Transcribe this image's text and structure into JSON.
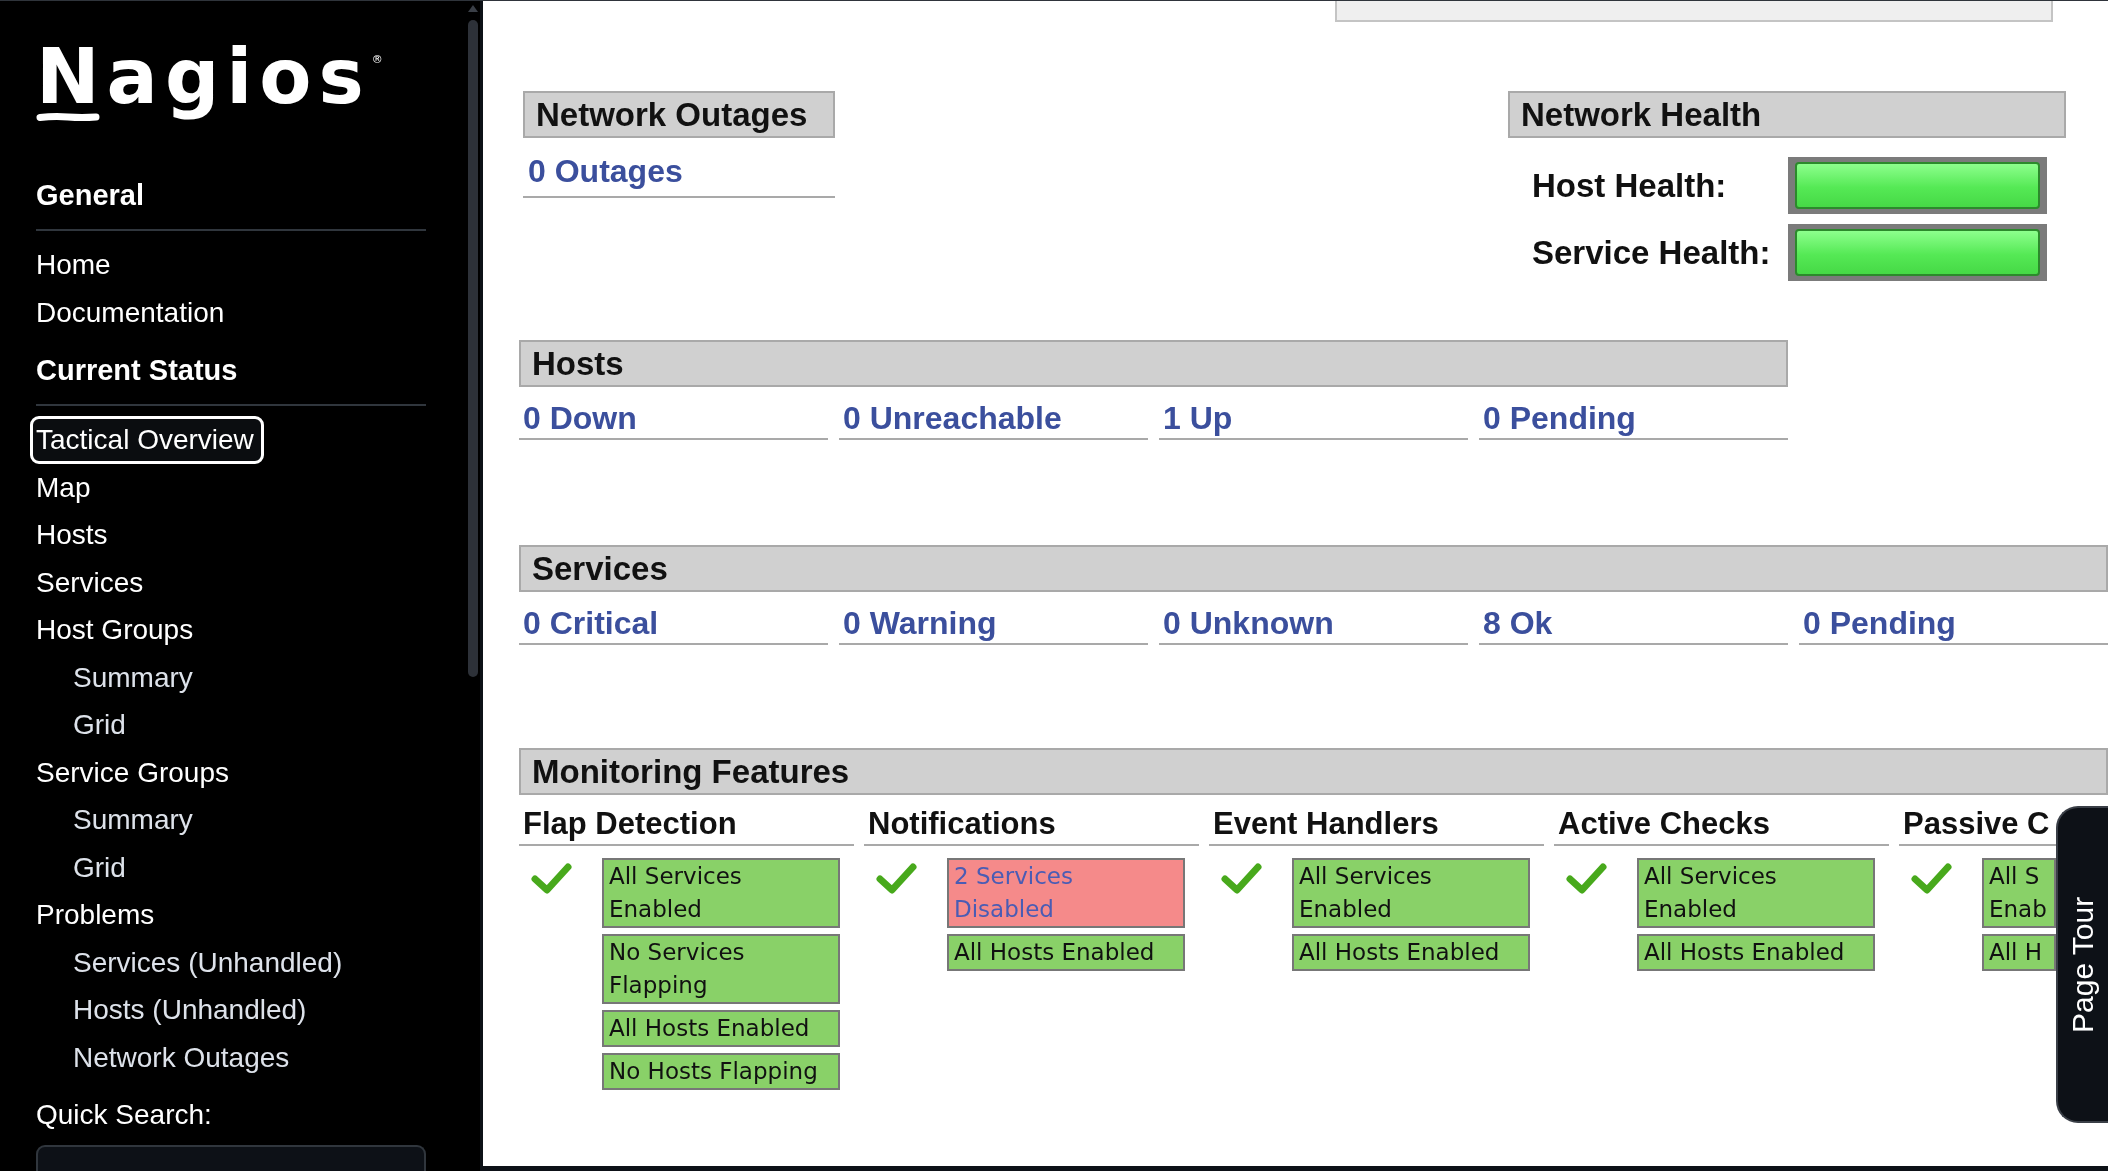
{
  "sidebar": {
    "logo": {
      "text": "Nagios",
      "mark": "®"
    },
    "sections": [
      {
        "title": "General",
        "items": [
          {
            "label": "Home",
            "selected": false
          },
          {
            "label": "Documentation",
            "selected": false
          }
        ]
      },
      {
        "title": "Current Status",
        "items": [
          {
            "label": "Tactical Overview",
            "selected": true
          },
          {
            "label": "Map",
            "selected": false
          },
          {
            "label": "Hosts",
            "selected": false
          },
          {
            "label": "Services",
            "selected": false
          },
          {
            "label": "Host Groups",
            "selected": false,
            "children": [
              {
                "label": "Summary",
                "selected": false
              },
              {
                "label": "Grid",
                "selected": false
              }
            ]
          },
          {
            "label": "Service Groups",
            "selected": false,
            "children": [
              {
                "label": "Summary",
                "selected": false
              },
              {
                "label": "Grid",
                "selected": false
              }
            ]
          },
          {
            "label": "Problems",
            "selected": false,
            "children": [
              {
                "label": "Services (Unhandled)",
                "selected": false
              },
              {
                "label": "Hosts (Unhandled)",
                "selected": false
              },
              {
                "label": "Network Outages",
                "selected": false
              }
            ]
          }
        ]
      }
    ],
    "quick_search": {
      "label": "Quick Search:"
    }
  },
  "network_outages": {
    "title": "Network Outages",
    "link": "0 Outages"
  },
  "network_health": {
    "title": "Network Health",
    "rows": [
      {
        "label": "Host Health:",
        "level": 1
      },
      {
        "label": "Service Health:",
        "level": 1
      }
    ]
  },
  "hosts": {
    "title": "Hosts",
    "counts": [
      "0 Down",
      "0 Unreachable",
      "1 Up",
      "0 Pending"
    ]
  },
  "services": {
    "title": "Services",
    "counts": [
      "0 Critical",
      "0 Warning",
      "0 Unknown",
      "8 Ok",
      "0 Pending"
    ]
  },
  "monitoring_features": {
    "title": "Monitoring Features",
    "columns": [
      {
        "title": "Flap Detection",
        "enabled": true,
        "badges": [
          {
            "text": "All Services Enabled",
            "ok": true
          },
          {
            "text": "No Services Flapping",
            "ok": true
          },
          {
            "text": "All Hosts Enabled",
            "ok": true
          },
          {
            "text": "No Hosts Flapping",
            "ok": true
          }
        ]
      },
      {
        "title": "Notifications",
        "enabled": true,
        "badges": [
          {
            "text": "2 Services Disabled",
            "ok": false
          },
          {
            "text": "All Hosts Enabled",
            "ok": true
          }
        ]
      },
      {
        "title": "Event Handlers",
        "enabled": true,
        "badges": [
          {
            "text": "All Services Enabled",
            "ok": true
          },
          {
            "text": "All Hosts Enabled",
            "ok": true
          }
        ]
      },
      {
        "title": "Active Checks",
        "enabled": true,
        "badges": [
          {
            "text": "All Services Enabled",
            "ok": true
          },
          {
            "text": "All Hosts Enabled",
            "ok": true
          }
        ]
      },
      {
        "title": "Passive C",
        "enabled": true,
        "badges": [
          {
            "text": "All S Enab",
            "ok": true
          },
          {
            "text": "All H",
            "ok": true
          }
        ]
      }
    ]
  },
  "page_tour": {
    "label": "Page Tour"
  }
}
